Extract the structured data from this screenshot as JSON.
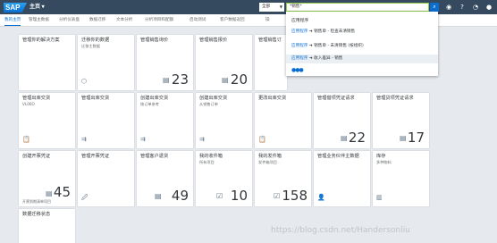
{
  "shell": {
    "logo": "SAP",
    "home": "主页 ▾",
    "scope": "全部",
    "search": "*销售*"
  },
  "tabs": [
    "我的主页",
    "管理主数据",
    "分析仪表盘",
    "数据迁移",
    "文本分析",
    "分析项目和配额",
    "启动测试",
    "客户数据返回",
    "操"
  ],
  "dropdown": {
    "header": "应用程序",
    "items": [
      {
        "app": "应用程序",
        "arrow": " ➜ ",
        "text": "销售单 - 检查未清销售",
        "note": ""
      },
      {
        "app": "应用程序",
        "arrow": " ➜ ",
        "text": "销售单 - 未清销售",
        "note": "(按组织)"
      },
      {
        "app": "应用程序",
        "arrow": " ➜ ",
        "text": "收入差异 - 销售",
        "note": ""
      }
    ],
    "more": "●●●"
  },
  "tiles": {
    "r1": [
      {
        "title": "管理你的解决方案",
        "sub": "",
        "num": "",
        "icon": ""
      },
      {
        "title": "迁移你的数据",
        "sub": "迁移主数据",
        "num": "",
        "icon": "⬡"
      },
      {
        "title": "管理销售询价",
        "sub": "",
        "num": "23",
        "icon": "▤"
      },
      {
        "title": "管理销售报价",
        "sub": "",
        "num": "20",
        "icon": "▤"
      },
      {
        "title": "管理销售订",
        "sub": "",
        "num": "",
        "icon": ""
      }
    ],
    "r2": [
      {
        "title": "管理出库交货",
        "sub": "VL06O",
        "num": "",
        "icon": "📋"
      },
      {
        "title": "管理出库交货",
        "sub": "",
        "num": "",
        "icon": "⇉"
      },
      {
        "title": "创建出库交货",
        "sub": "按订单参考",
        "num": "",
        "icon": "⇉"
      },
      {
        "title": "创建出库交货",
        "sub": "从销售订单",
        "num": "",
        "icon": "⇉"
      },
      {
        "title": "更改出库交货",
        "sub": "",
        "num": "",
        "icon": "📋"
      },
      {
        "title": "管理借项凭证请求",
        "sub": "",
        "num": "22",
        "icon": "▤"
      },
      {
        "title": "管理贷项凭证请求",
        "sub": "",
        "num": "17",
        "icon": "▤"
      }
    ],
    "r3": [
      {
        "title": "创建开票凭证",
        "sub": "",
        "num": "45",
        "icon": "▤",
        "foot": "开票到期清单项目"
      },
      {
        "title": "管理开票凭证",
        "sub": "",
        "num": "",
        "icon": "🖉"
      },
      {
        "title": "管理客户退货",
        "sub": "",
        "num": "49",
        "icon": "▤"
      },
      {
        "title": "我的收件箱",
        "sub": "所有项目",
        "num": "10",
        "icon": "☑"
      },
      {
        "title": "我的发件箱",
        "sub": "发件箱项目",
        "num": "158",
        "icon": "☑"
      },
      {
        "title": "管理业务伙伴主数据",
        "sub": "",
        "num": "",
        "icon": "👤"
      },
      {
        "title": "库存",
        "sub": "多种物料",
        "num": "",
        "icon": "▥"
      }
    ],
    "r4": [
      {
        "title": "数据迁移状态",
        "sub": "",
        "num": "",
        "icon": ""
      }
    ]
  },
  "watermark": "https://blog.csdn.net/Handersonliu"
}
